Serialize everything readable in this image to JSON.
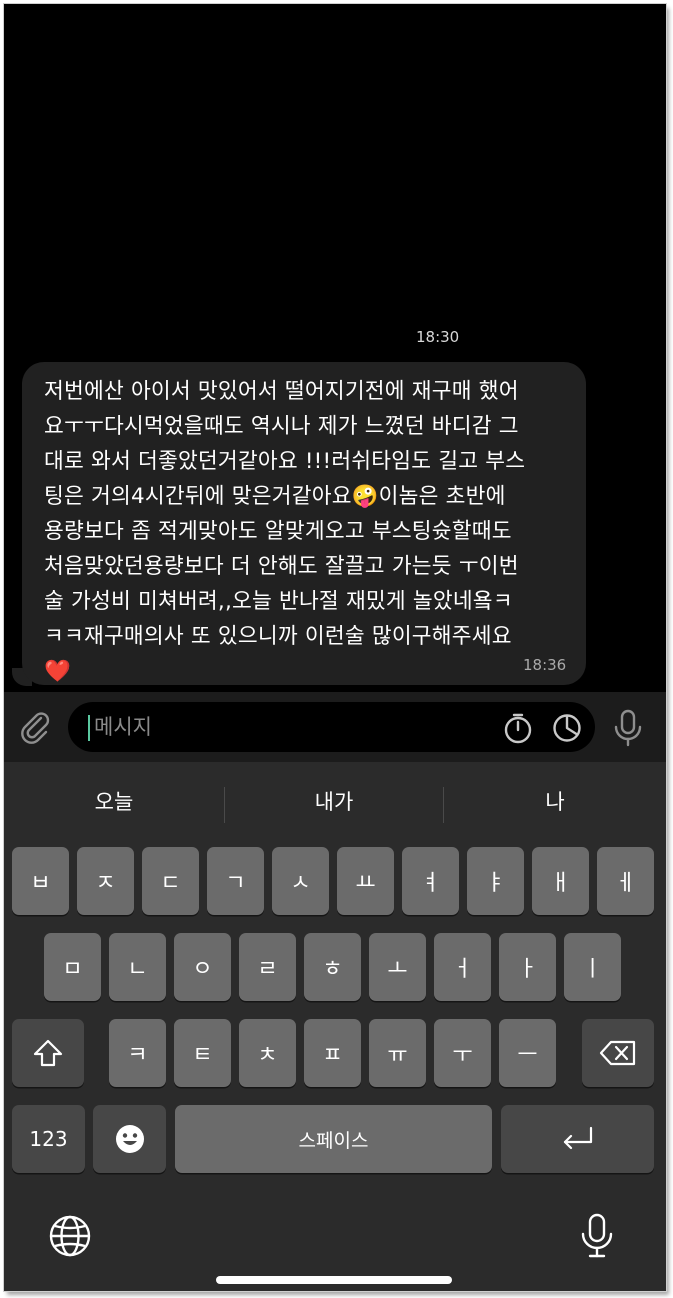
{
  "chat": {
    "previous_message_time": "18:30",
    "message": {
      "text": "저번에산 아이서 맛있어서 떨어지기전에 재구매 했어\n요ㅜㅜ다시먹었을때도 역시나 제가 느꼈던 바디감 그\n대로 와서 더좋았던거같아요 !!!러쉬타임도 길고 부스\n팅은 거의4시간뒤에 맞은거같아요🤪이놈은 초반에\n용량보다 좀 적게맞아도 알맞게오고 부스팅슛할때도\n처음맞았던용량보다 더 안해도 잘끌고 가는듯 ㅜ이번\n술 가성비 미쳐버려,,오늘 반나절 재밌게 놀았네욬ㅋ\nㅋㅋ재구매의사 또 있으니까 이런술 많이구해주세요\n❤️",
      "time": "18:36"
    }
  },
  "input_bar": {
    "placeholder": "메시지",
    "icons": [
      "attach-icon",
      "timer-icon",
      "sticker-icon",
      "mic-icon"
    ]
  },
  "keyboard": {
    "suggestions": [
      "오늘",
      "내가",
      "나"
    ],
    "row1": [
      "ㅂ",
      "ㅈ",
      "ㄷ",
      "ㄱ",
      "ㅅ",
      "ㅛ",
      "ㅕ",
      "ㅑ",
      "ㅐ",
      "ㅔ"
    ],
    "row2": [
      "ㅁ",
      "ㄴ",
      "ㅇ",
      "ㄹ",
      "ㅎ",
      "ㅗ",
      "ㅓ",
      "ㅏ",
      "ㅣ"
    ],
    "row3": [
      "ㅋ",
      "ㅌ",
      "ㅊ",
      "ㅍ",
      "ㅠ",
      "ㅜ",
      "ㅡ"
    ],
    "shift_icon": "shift-arrow-icon",
    "backspace_icon": "backspace-icon",
    "numbers_label": "123",
    "emoji_icon": "emoji-smiley-icon",
    "space_label": "스페이스",
    "return_icon": "return-arrow-icon",
    "globe_icon": "globe-icon",
    "dictation_icon": "microphone-icon"
  },
  "colors": {
    "chat_background": "#000000",
    "bubble": "#212121",
    "keyboard_background": "#2b2b2b",
    "key": "#6b6b6b",
    "function_key": "#474747",
    "caret": "#5ac8a0"
  }
}
